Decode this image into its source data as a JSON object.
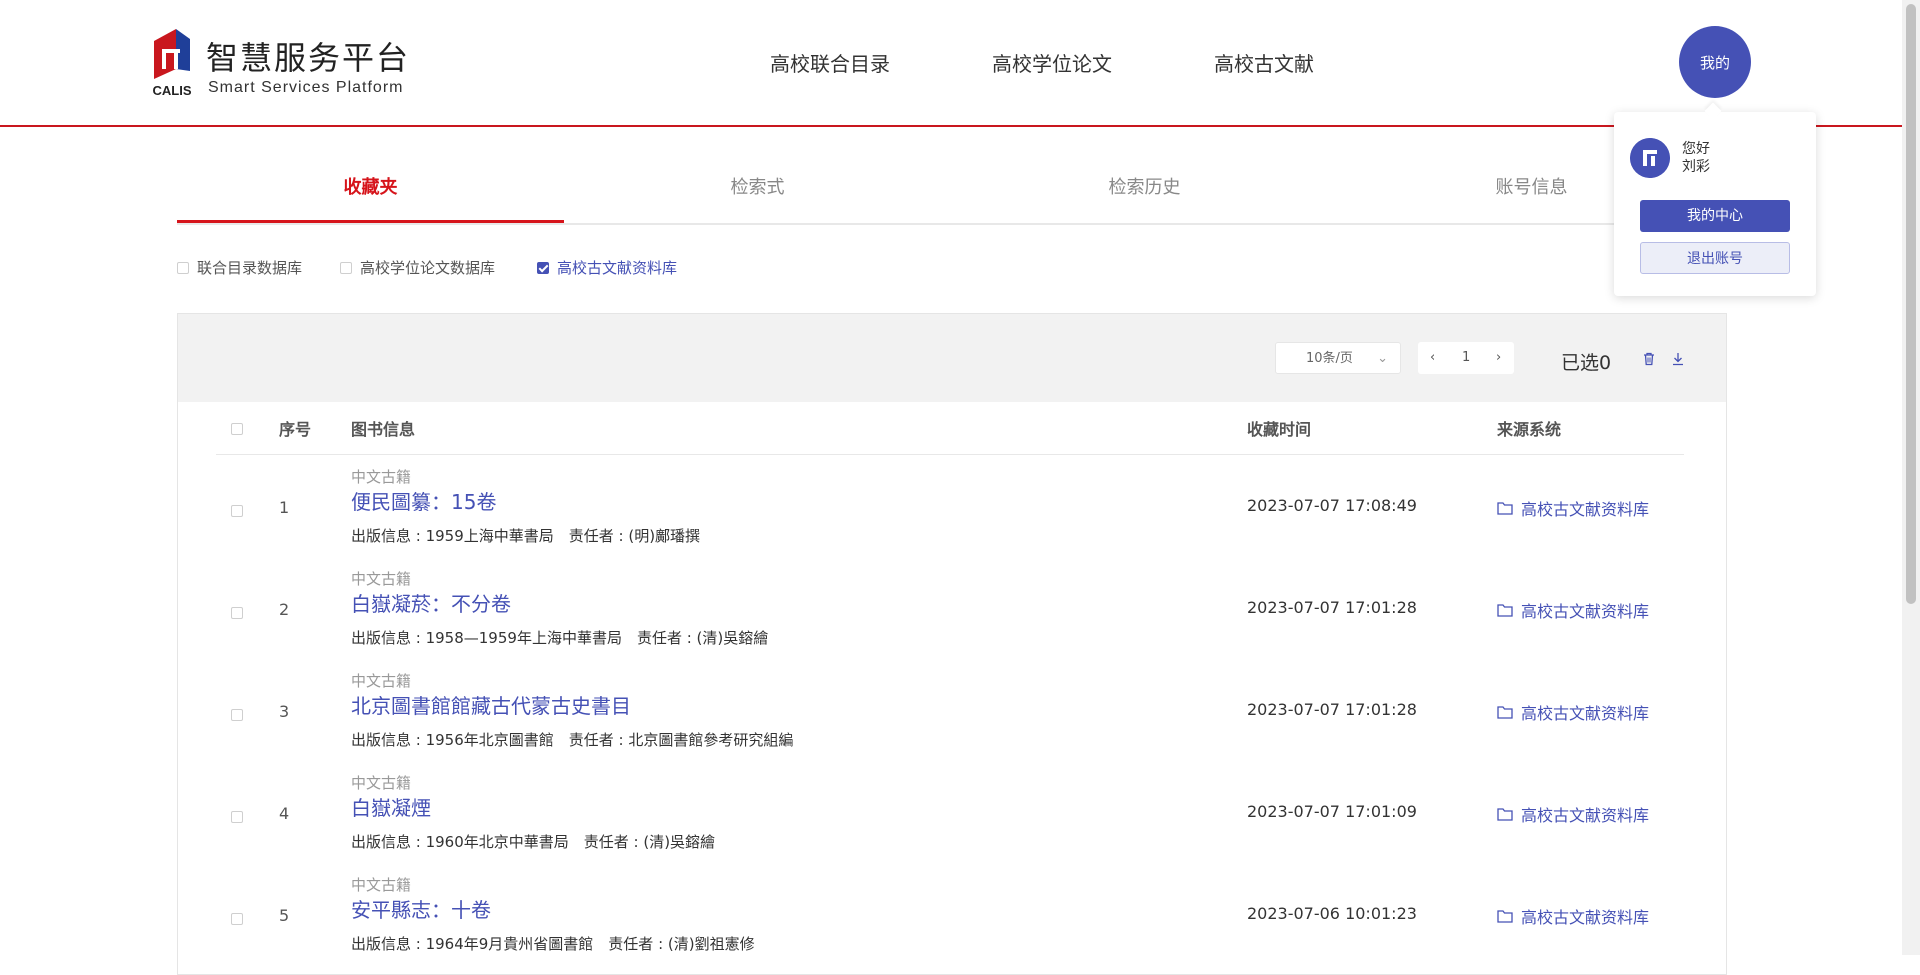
{
  "brand": {
    "name_cn": "智慧服务平台",
    "name_en": "Smart Services Platform",
    "logo_text": "CALIS",
    "logo_color": "#c9171e"
  },
  "nav": {
    "items": [
      "高校联合目录",
      "高校学位论文",
      "高校古文献"
    ],
    "user_button": "我的"
  },
  "tabs": {
    "items": [
      "收藏夹",
      "检索式",
      "检索历史",
      "账号信息"
    ],
    "active": "收藏夹"
  },
  "filters": {
    "items": [
      {
        "label": "联合目录数据库",
        "checked": false
      },
      {
        "label": "高校学位论文数据库",
        "checked": false
      },
      {
        "label": "高校古文献资料库",
        "checked": true
      }
    ]
  },
  "toolbar": {
    "page_size": "10条/页",
    "current_page": "1",
    "prev": "‹",
    "next": "›",
    "selected_text": "已选0",
    "delete_icon": "trash-icon",
    "download_icon": "download-icon"
  },
  "table": {
    "headers": {
      "index": "序号",
      "book": "图书信息",
      "time": "收藏时间",
      "source": "来源系统"
    },
    "rows": [
      {
        "index": "1",
        "kind": "中文古籍",
        "title": "便民圖纂：15卷",
        "pub": "出版信息 : 1959上海中華書局　责任者 : (明)鄺璠撰",
        "time": "2023-07-07 17:08:49",
        "source": "高校古文献资料库"
      },
      {
        "index": "2",
        "kind": "中文古籍",
        "title": "白嶽凝菸：不分卷",
        "pub": "出版信息 : 1958—1959年上海中華書局　责任者 : (清)吳鎔繪",
        "time": "2023-07-07 17:01:28",
        "source": "高校古文献资料库"
      },
      {
        "index": "3",
        "kind": "中文古籍",
        "title": "北京圖書館館藏古代蒙古史書目",
        "pub": "出版信息 : 1956年北京圖書館　责任者 : 北京圖書館參考研究組編",
        "time": "2023-07-07 17:01:28",
        "source": "高校古文献资料库"
      },
      {
        "index": "4",
        "kind": "中文古籍",
        "title": "白嶽凝煙",
        "pub": "出版信息 : 1960年北京中華書局　责任者 : (清)吳鎔繪",
        "time": "2023-07-07 17:01:09",
        "source": "高校古文献资料库"
      },
      {
        "index": "5",
        "kind": "中文古籍",
        "title": "安平縣志：十卷",
        "pub": "出版信息 : 1964年9月貴州省圖書館　责任者 : (清)劉祖憲修",
        "time": "2023-07-06 10:01:23",
        "source": "高校古文献资料库"
      }
    ]
  },
  "popup": {
    "greeting": "您好",
    "username": "刘彩",
    "center_button": "我的中心",
    "logout_button": "退出账号"
  },
  "colors": {
    "accent": "#4551b5",
    "active_tab": "#d6141b",
    "header_line": "#c9171e"
  }
}
